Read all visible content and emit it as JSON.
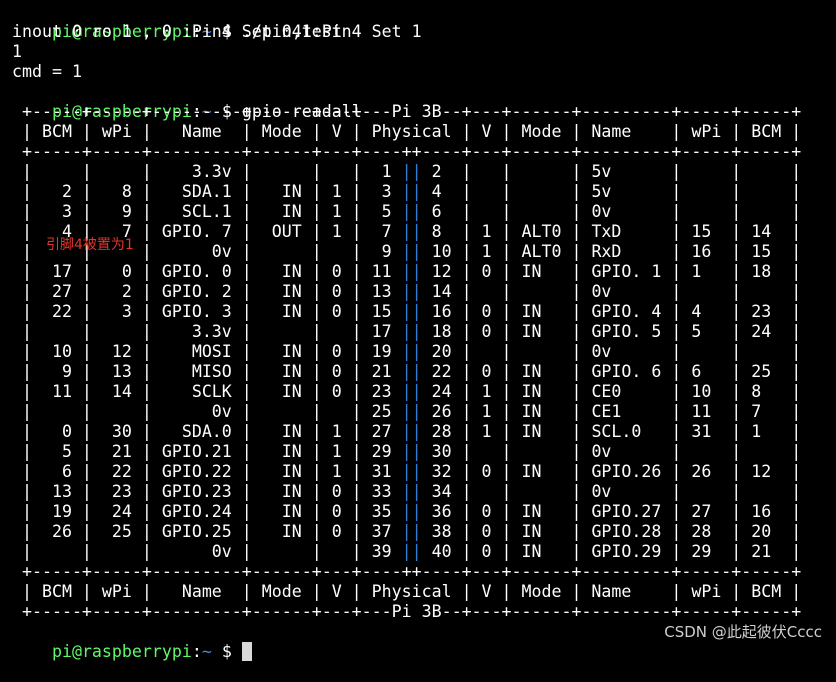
{
  "terminal": {
    "prompt": {
      "user": "pi@raspberrypi",
      "sep": ":",
      "path": "~",
      "symbol": " $ "
    },
    "commands": {
      "first": "./pin4test",
      "second": "gpio readall"
    },
    "output": [
      "inout 0 ro 1 , 0 :Pin4 Set 0,1:Pin4 Set 1",
      "1",
      "cmd = 1"
    ],
    "table": {
      "top_border": " +-----+-----+---------+------+---+---Pi 3B--+---+------+---------+-----+-----+",
      "header": " | BCM | wPi |   Name  | Mode | V | Physical | V | Mode | Name    | wPi | BCM |",
      "sep_a": " +-----+-----+---------+------+---+----++----+---+------+---------+-----+-----+",
      "rows": [
        {
          "left": " |     |     |    3.3v |      |   |  1 ",
          "right": " 2  |   |      | 5v      |     |     |"
        },
        {
          "left": " |   2 |   8 |   SDA.1 |   IN | 1 |  3 ",
          "right": " 4  |   |      | 5v      |     |     |"
        },
        {
          "left": " |   3 |   9 |   SCL.1 |   IN | 1 |  5 ",
          "right": " 6  |   |      | 0v      |     |     |"
        },
        {
          "left": " |   4 |   7 | GPIO. 7 |  OUT | 1 |  7 ",
          "right": " 8  | 1 | ALT0 | TxD     | 15  | 14  |"
        },
        {
          "left": " |     |     |      0v |      |   |  9 ",
          "right": " 10 | 1 | ALT0 | RxD     | 16  | 15  |"
        },
        {
          "left": " |  17 |   0 | GPIO. 0 |   IN | 0 | 11 ",
          "right": " 12 | 0 | IN   | GPIO. 1 | 1   | 18  |"
        },
        {
          "left": " |  27 |   2 | GPIO. 2 |   IN | 0 | 13 ",
          "right": " 14 |   |      | 0v      |     |     |"
        },
        {
          "left": " |  22 |   3 | GPIO. 3 |   IN | 0 | 15 ",
          "right": " 16 | 0 | IN   | GPIO. 4 | 4   | 23  |"
        },
        {
          "left": " |     |     |    3.3v |      |   | 17 ",
          "right": " 18 | 0 | IN   | GPIO. 5 | 5   | 24  |"
        },
        {
          "left": " |  10 |  12 |    MOSI |   IN | 0 | 19 ",
          "right": " 20 |   |      | 0v      |     |     |"
        },
        {
          "left": " |   9 |  13 |    MISO |   IN | 0 | 21 ",
          "right": " 22 | 0 | IN   | GPIO. 6 | 6   | 25  |"
        },
        {
          "left": " |  11 |  14 |    SCLK |   IN | 0 | 23 ",
          "right": " 24 | 1 | IN   | CE0     | 10  | 8   |"
        },
        {
          "left": " |     |     |      0v |      |   | 25 ",
          "right": " 26 | 1 | IN   | CE1     | 11  | 7   |"
        },
        {
          "left": " |   0 |  30 |   SDA.0 |   IN | 1 | 27 ",
          "right": " 28 | 1 | IN   | SCL.0   | 31  | 1   |"
        },
        {
          "left": " |   5 |  21 | GPIO.21 |   IN | 1 | 29 ",
          "right": " 30 |   |      | 0v      |     |     |"
        },
        {
          "left": " |   6 |  22 | GPIO.22 |   IN | 1 | 31 ",
          "right": " 32 | 0 | IN   | GPIO.26 | 26  | 12  |"
        },
        {
          "left": " |  13 |  23 | GPIO.23 |   IN | 0 | 33 ",
          "right": " 34 |   |      | 0v      |     |     |"
        },
        {
          "left": " |  19 |  24 | GPIO.24 |   IN | 0 | 35 ",
          "right": " 36 | 0 | IN   | GPIO.27 | 27  | 16  |"
        },
        {
          "left": " |  26 |  25 | GPIO.25 |   IN | 0 | 37 ",
          "right": " 38 | 0 | IN   | GPIO.28 | 28  | 20  |"
        },
        {
          "left": " |     |     |      0v |      |   | 39 ",
          "right": " 40 | 0 | IN   | GPIO.29 | 29  | 21  |"
        }
      ],
      "phys_sep": "||",
      "sep_b": " +-----+-----+---------+------+---+----++----+---+------+---------+-----+-----+",
      "footer_header": " | BCM | wPi |   Name  | Mode | V | Physical | V | Mode | Name    | wPi | BCM |",
      "bottom_border": " +-----+-----+---------+------+---+---Pi 3B--+---+------+---------+-----+-----+"
    }
  },
  "annotation": {
    "text": "引脚4被置为1",
    "color": "#e8332a"
  },
  "watermark": "CSDN @此起彼伏Cccc",
  "colors": {
    "background": "#000000",
    "text": "#ffffff",
    "prompt_user": "#5ff967",
    "prompt_path": "#3b8eea",
    "physical_separator": "#2f7fd6"
  }
}
